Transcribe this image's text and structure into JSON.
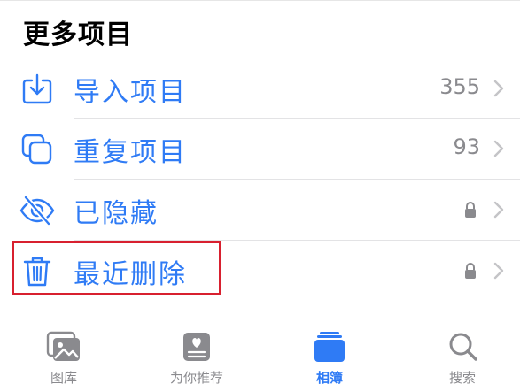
{
  "section": {
    "title": "更多项目"
  },
  "rows": [
    {
      "label": "导入项目",
      "count": "355",
      "icon": "import-tray-icon"
    },
    {
      "label": "重复项目",
      "count": "93",
      "icon": "duplicate-copy-icon"
    },
    {
      "label": "已隐藏",
      "count": "",
      "icon": "eye-slash-icon",
      "locked": true
    },
    {
      "label": "最近删除",
      "count": "",
      "icon": "trash-icon",
      "locked": true,
      "highlighted": true
    }
  ],
  "tabbar": {
    "tabs": [
      {
        "label": "图库",
        "icon": "photos-library-icon",
        "active": false
      },
      {
        "label": "为你推荐",
        "icon": "for-you-icon",
        "active": false
      },
      {
        "label": "相簿",
        "icon": "albums-icon",
        "active": true
      },
      {
        "label": "搜索",
        "icon": "search-icon",
        "active": false
      }
    ]
  },
  "colors": {
    "accent": "#2f7bf5",
    "secondary_text": "#8a8a8e",
    "highlight": "#d8202f"
  }
}
